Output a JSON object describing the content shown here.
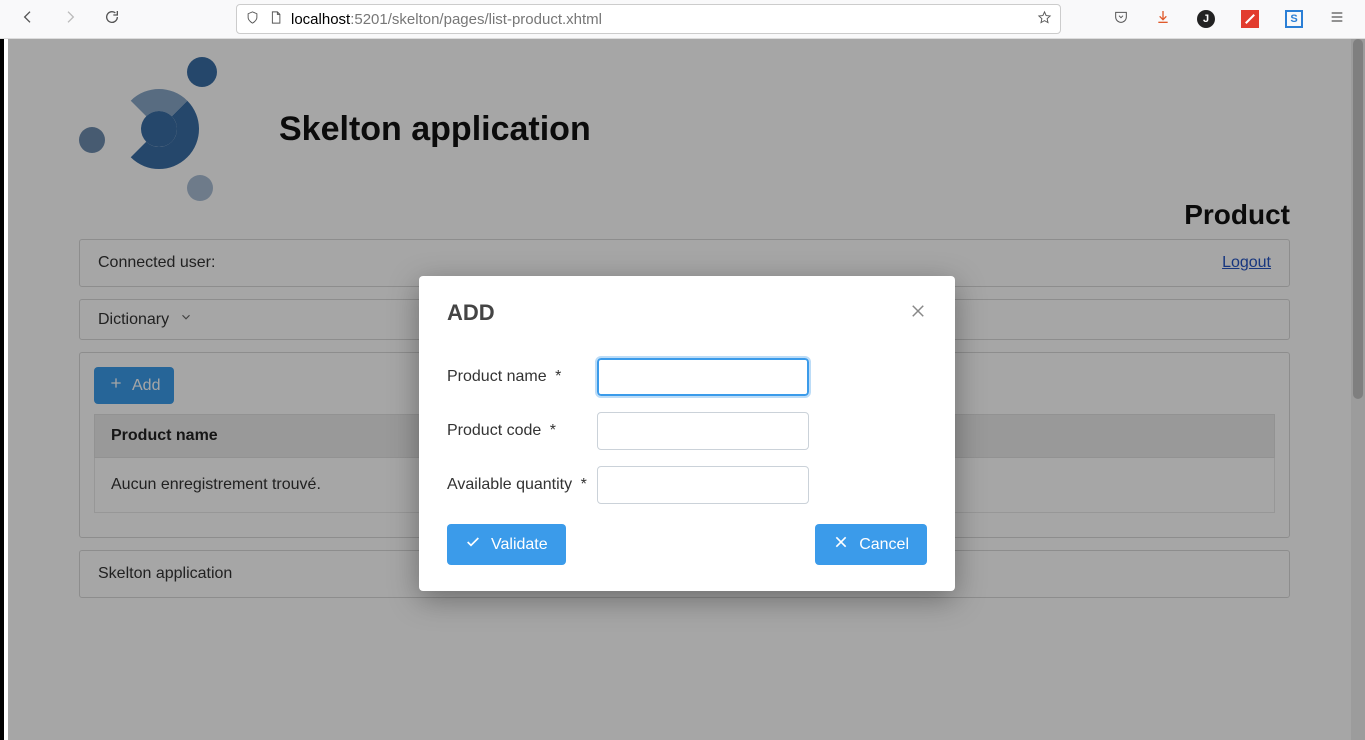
{
  "browser": {
    "url_host": "localhost",
    "url_rest": ":5201/skelton/pages/list-product.xhtml",
    "profile_initial": "J",
    "s_badge": "S"
  },
  "app": {
    "title": "Skelton application"
  },
  "page": {
    "title": "Product",
    "connected_user_label": "Connected user:",
    "logout": "Logout",
    "menu_dictionary": "Dictionary",
    "add_button": "Add",
    "table": {
      "column_product_name": "Product name",
      "empty_message": "Aucun enregistrement trouvé."
    },
    "footer": "Skelton application"
  },
  "modal": {
    "title": "ADD",
    "fields": {
      "product_name": {
        "label": "Product name",
        "required": "*",
        "value": ""
      },
      "product_code": {
        "label": "Product code",
        "required": "*",
        "value": ""
      },
      "available_quantity": {
        "label": "Available quantity",
        "required": "*",
        "value": ""
      }
    },
    "actions": {
      "validate": "Validate",
      "cancel": "Cancel"
    }
  }
}
